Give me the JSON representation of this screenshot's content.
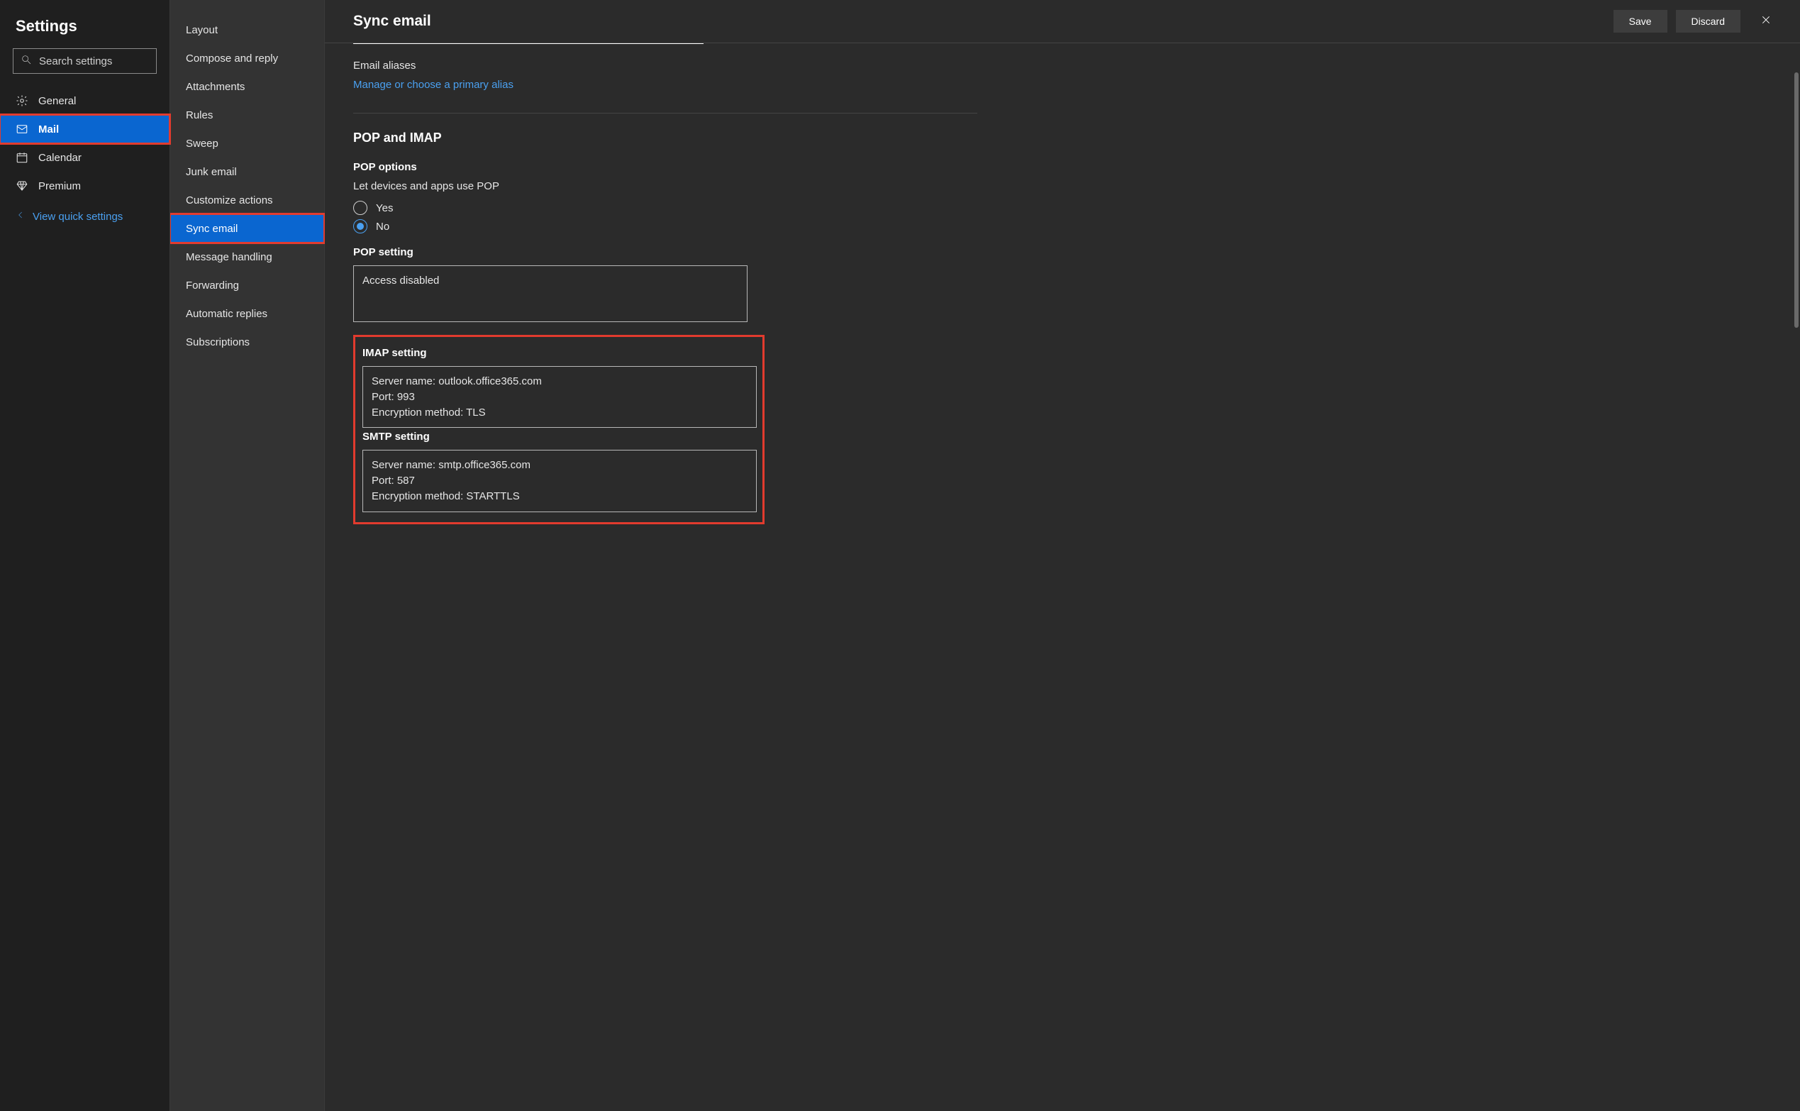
{
  "sidebar": {
    "title": "Settings",
    "search_placeholder": "Search settings",
    "categories": [
      {
        "id": "general",
        "label": "General",
        "icon": "gear"
      },
      {
        "id": "mail",
        "label": "Mail",
        "icon": "mail",
        "selected": true
      },
      {
        "id": "calendar",
        "label": "Calendar",
        "icon": "calendar"
      },
      {
        "id": "premium",
        "label": "Premium",
        "icon": "diamond"
      }
    ],
    "quick_link": "View quick settings"
  },
  "submenu": {
    "items": [
      "Layout",
      "Compose and reply",
      "Attachments",
      "Rules",
      "Sweep",
      "Junk email",
      "Customize actions",
      "Sync email",
      "Message handling",
      "Forwarding",
      "Automatic replies",
      "Subscriptions"
    ],
    "selected_index": 7
  },
  "header": {
    "title": "Sync email",
    "save": "Save",
    "discard": "Discard"
  },
  "content": {
    "aliases_label": "Email aliases",
    "aliases_link": "Manage or choose a primary alias",
    "pop_imap_title": "POP and IMAP",
    "pop_options_title": "POP options",
    "pop_options_desc": "Let devices and apps use POP",
    "pop_option_yes": "Yes",
    "pop_option_no": "No",
    "pop_option_selected": "No",
    "pop_setting_title": "POP setting",
    "pop_setting_value": "Access disabled",
    "imap_title": "IMAP setting",
    "imap_server": "Server name: outlook.office365.com",
    "imap_port": "Port: 993",
    "imap_enc": "Encryption method: TLS",
    "smtp_title": "SMTP setting",
    "smtp_server": "Server name: smtp.office365.com",
    "smtp_port": "Port: 587",
    "smtp_enc": "Encryption method: STARTTLS"
  }
}
